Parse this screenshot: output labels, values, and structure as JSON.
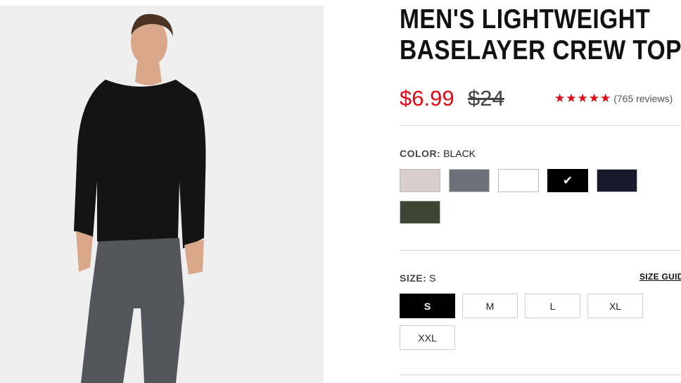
{
  "product": {
    "title_line1": "MEN'S LIGHTWEIGHT",
    "title_line2": "BASELAYER CREW TOP",
    "sale_price": "$6.99",
    "original_price": "$24",
    "stars": "★★★★★",
    "reviews": "(765 reviews)"
  },
  "color": {
    "label": "COLOR:",
    "selected": "BLACK",
    "swatches": [
      {
        "name": "Light Taupe",
        "hex": "#d8cfcd"
      },
      {
        "name": "Charcoal",
        "hex": "#6b7178"
      },
      {
        "name": "White",
        "hex": "#ffffff"
      },
      {
        "name": "Black",
        "hex": "#000000",
        "selected": true
      },
      {
        "name": "Navy",
        "hex": "#161a2b"
      },
      {
        "name": "Olive",
        "hex": "#3d4632"
      }
    ],
    "check_glyph": "✔"
  },
  "size": {
    "label": "SIZE:",
    "selected": "S",
    "guide": "SIZE GUIDE",
    "options": [
      "S",
      "M",
      "L",
      "XL",
      "XXL"
    ]
  },
  "colors": {
    "accent_red": "#e30613",
    "image_bg": "#efefef"
  },
  "icons": {
    "star": "star-icon",
    "check": "check-icon"
  }
}
